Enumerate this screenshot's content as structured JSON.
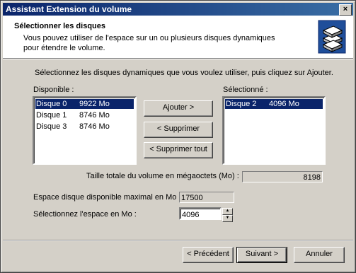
{
  "window": {
    "title": "Assistant Extension du volume",
    "close_glyph": "×"
  },
  "header": {
    "title": "Sélectionner les disques",
    "subtitle": "Vous pouvez utiliser de l'espace sur un ou plusieurs disques dynamiques pour étendre le volume.",
    "icon": "disks-stack-icon"
  },
  "instruction": "Sélectionnez les disques dynamiques que vous voulez utiliser, puis cliquez sur Ajouter.",
  "available": {
    "label": "Disponible :",
    "items": [
      {
        "disk": "Disque 0",
        "size": "9922 Mo",
        "selected": true
      },
      {
        "disk": "Disque 1",
        "size": "8746 Mo",
        "selected": false
      },
      {
        "disk": "Disque 3",
        "size": "8746 Mo",
        "selected": false
      }
    ]
  },
  "selected": {
    "label": "Sélectionné :",
    "items": [
      {
        "disk": "Disque 2",
        "size": "4096 Mo",
        "selected": true
      }
    ]
  },
  "buttons": {
    "add": "Ajouter >",
    "remove": "< Supprimer",
    "remove_all": "< Supprimer tout",
    "back": "< Précédent",
    "next": "Suivant >",
    "cancel": "Annuler"
  },
  "total": {
    "label": "Taille totale du volume en mégaoctets (Mo) :",
    "value": "8198"
  },
  "max_space": {
    "label": "Espace disque disponible maximal en Mo :",
    "value": "17500"
  },
  "space": {
    "label": "Sélectionnez l'espace en Mo :",
    "value": "4096"
  },
  "colors": {
    "title_start": "#0a246a",
    "title_end": "#3a6ea5",
    "selection": "#0a246a",
    "face": "#d4d0c8"
  }
}
